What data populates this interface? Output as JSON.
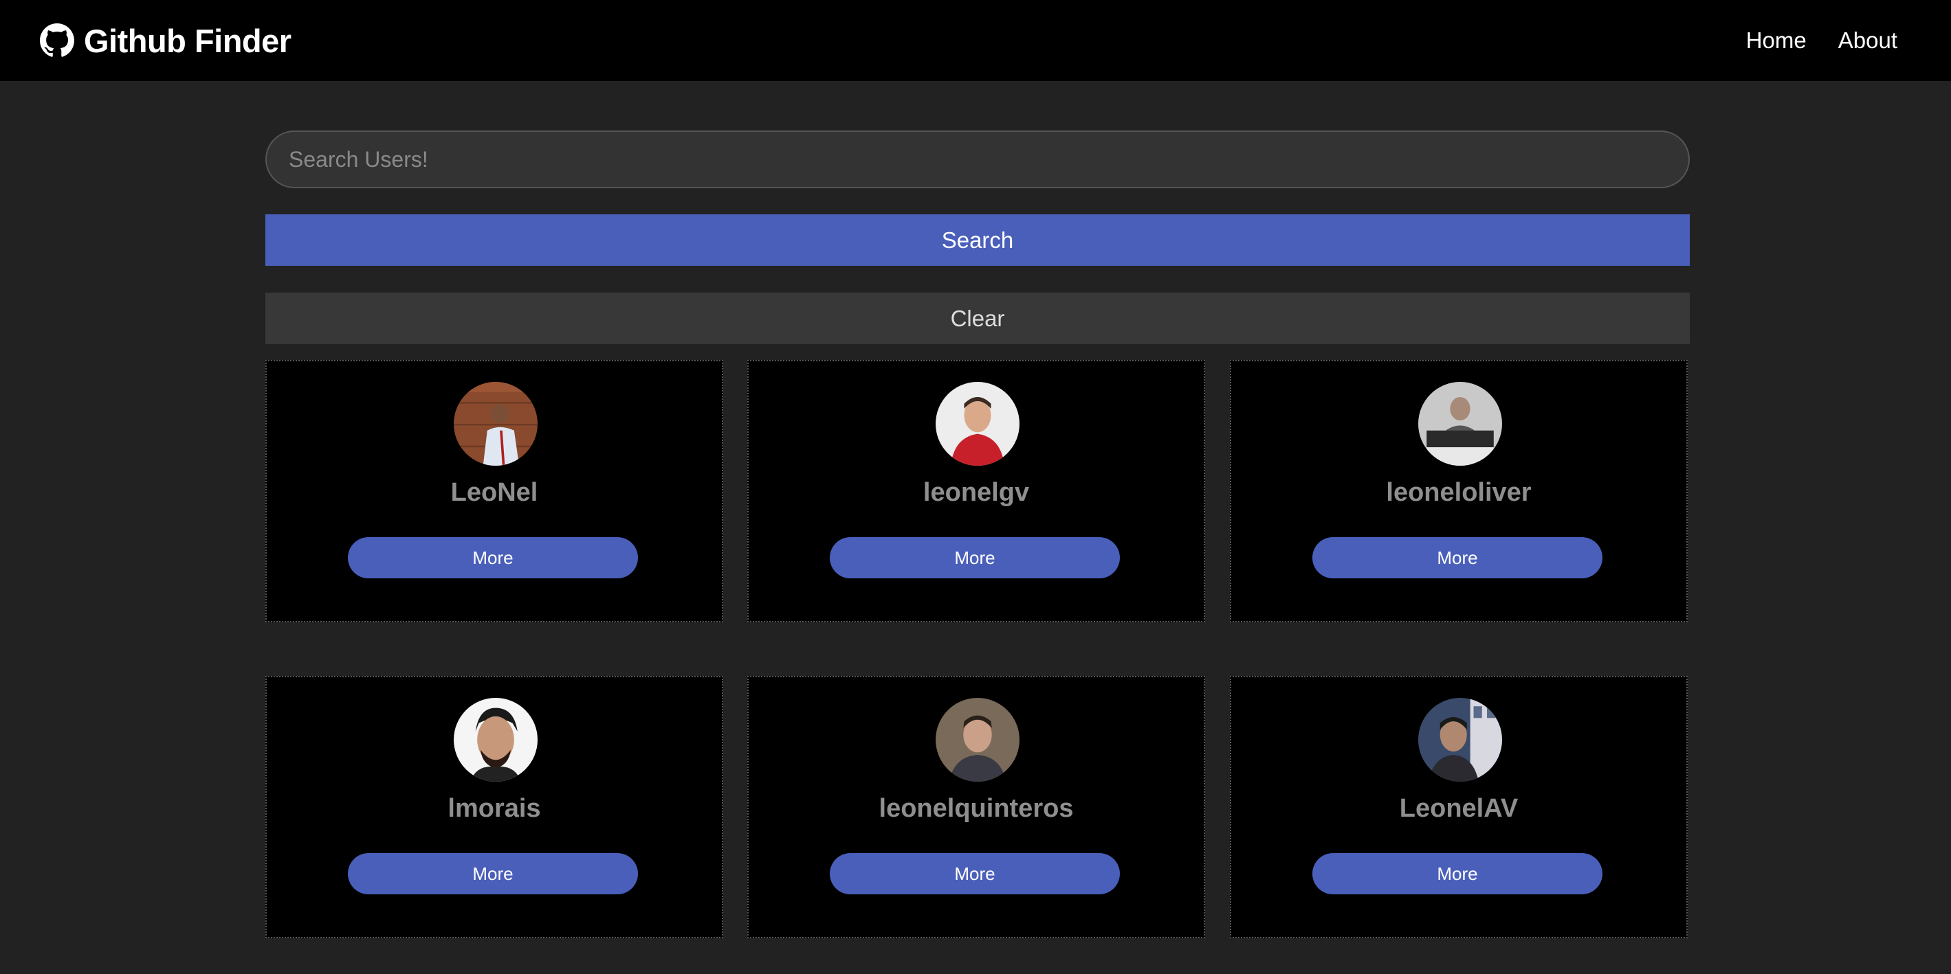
{
  "navbar": {
    "brand_icon": "github-icon",
    "title": "Github Finder",
    "links": [
      {
        "label": "Home"
      },
      {
        "label": "About"
      }
    ]
  },
  "search": {
    "placeholder": "Search Users!",
    "value": "",
    "search_label": "Search",
    "clear_label": "Clear"
  },
  "users": [
    {
      "login": "LeoNel",
      "more_label": "More",
      "avatar_bg": "#8a4a2e"
    },
    {
      "login": "leonelgv",
      "more_label": "More",
      "avatar_bg": "#e8e8e8"
    },
    {
      "login": "leoneloliver",
      "more_label": "More",
      "avatar_bg": "#c9c9c9"
    },
    {
      "login": "lmorais",
      "more_label": "More",
      "avatar_bg": "#f2f2f2"
    },
    {
      "login": "leonelquinteros",
      "more_label": "More",
      "avatar_bg": "#7a6a5a"
    },
    {
      "login": "LeonelAV",
      "more_label": "More",
      "avatar_bg": "#3a4a6a"
    }
  ],
  "colors": {
    "accent": "#4a5fba",
    "background": "#222222",
    "navbar": "#000000",
    "card": "#000000"
  }
}
